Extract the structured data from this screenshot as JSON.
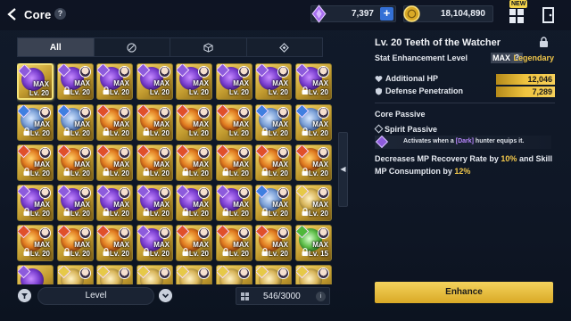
{
  "header": {
    "title": "Core",
    "help": "?",
    "crystal_amount": "7,397",
    "plus": "+",
    "gold_amount": "18,104,890",
    "new_badge": "NEW",
    "colors": {
      "accent": "#f2c84b",
      "crystal": "#a86ff0",
      "gold": "#d9a926"
    }
  },
  "tabs": [
    {
      "label": "All",
      "icon": "none"
    },
    {
      "label": "",
      "icon": "no-filter-icon"
    },
    {
      "label": "",
      "icon": "cube-icon"
    },
    {
      "label": "",
      "icon": "diamond-icon"
    }
  ],
  "core_grid": {
    "max_label": "MAX",
    "rows": [
      [
        {
          "lv": "Lv. 20",
          "max": true,
          "el": "dark",
          "face": false,
          "lock": false,
          "sel": true
        },
        {
          "lv": "Lv. 20",
          "max": true,
          "el": "dark",
          "face": true,
          "lock": true
        },
        {
          "lv": "Lv. 20",
          "max": true,
          "el": "dark",
          "face": true,
          "lock": true
        },
        {
          "lv": "Lv. 20",
          "max": true,
          "el": "dark",
          "face": true,
          "lock": false
        },
        {
          "lv": "Lv. 20",
          "max": true,
          "el": "dark",
          "face": true,
          "lock": false
        },
        {
          "lv": "Lv. 20",
          "max": true,
          "el": "dark",
          "face": true,
          "lock": false
        },
        {
          "lv": "Lv. 20",
          "max": true,
          "el": "dark",
          "face": true,
          "lock": false
        },
        {
          "lv": "Lv. 20",
          "max": true,
          "el": "dark",
          "face": true,
          "lock": true
        }
      ],
      [
        {
          "lv": "Lv. 20",
          "max": true,
          "el": "water",
          "face": true,
          "lock": true
        },
        {
          "lv": "Lv. 20",
          "max": true,
          "el": "water",
          "face": true,
          "lock": true
        },
        {
          "lv": "Lv. 20",
          "max": true,
          "el": "fire",
          "face": true,
          "lock": true
        },
        {
          "lv": "Lv. 20",
          "max": true,
          "el": "fire",
          "face": true,
          "lock": true
        },
        {
          "lv": "Lv. 20",
          "max": true,
          "el": "fire",
          "face": true,
          "lock": false
        },
        {
          "lv": "Lv. 20",
          "max": true,
          "el": "fire",
          "face": true,
          "lock": false
        },
        {
          "lv": "Lv. 20",
          "max": true,
          "el": "water",
          "face": true,
          "lock": true
        },
        {
          "lv": "Lv. 20",
          "max": true,
          "el": "water",
          "face": true,
          "lock": true
        }
      ],
      [
        {
          "lv": "Lv. 20",
          "max": true,
          "el": "fire",
          "face": true,
          "lock": true
        },
        {
          "lv": "Lv. 20",
          "max": true,
          "el": "fire",
          "face": true,
          "lock": true
        },
        {
          "lv": "Lv. 20",
          "max": true,
          "el": "fire",
          "face": true,
          "lock": true
        },
        {
          "lv": "Lv. 20",
          "max": true,
          "el": "fire",
          "face": true,
          "lock": true
        },
        {
          "lv": "Lv. 20",
          "max": true,
          "el": "fire",
          "face": true,
          "lock": true
        },
        {
          "lv": "Lv. 20",
          "max": true,
          "el": "fire",
          "face": true,
          "lock": true
        },
        {
          "lv": "Lv. 20",
          "max": true,
          "el": "fire",
          "face": true,
          "lock": true
        },
        {
          "lv": "Lv. 20",
          "max": true,
          "el": "fire",
          "face": true,
          "lock": true
        }
      ],
      [
        {
          "lv": "Lv. 20",
          "max": true,
          "el": "dark",
          "face": true,
          "lock": true
        },
        {
          "lv": "Lv. 20",
          "max": true,
          "el": "dark",
          "face": true,
          "lock": true
        },
        {
          "lv": "Lv. 20",
          "max": true,
          "el": "dark",
          "face": true,
          "lock": true
        },
        {
          "lv": "Lv. 20",
          "max": true,
          "el": "dark",
          "face": true,
          "lock": true
        },
        {
          "lv": "Lv. 20",
          "max": true,
          "el": "dark",
          "face": true,
          "lock": true
        },
        {
          "lv": "Lv. 20",
          "max": true,
          "el": "dark",
          "face": true,
          "lock": true
        },
        {
          "lv": "Lv. 20",
          "max": true,
          "el": "water",
          "face": true,
          "lock": true
        },
        {
          "lv": "Lv. 20",
          "max": true,
          "el": "light",
          "face": true,
          "lock": true
        }
      ],
      [
        {
          "lv": "Lv. 20",
          "max": true,
          "el": "fire",
          "face": true,
          "lock": true
        },
        {
          "lv": "Lv. 20",
          "max": true,
          "el": "fire",
          "face": true,
          "lock": true
        },
        {
          "lv": "Lv. 20",
          "max": true,
          "el": "fire",
          "face": true,
          "lock": true
        },
        {
          "lv": "Lv. 20",
          "max": true,
          "el": "dark",
          "face": true,
          "lock": true
        },
        {
          "lv": "Lv. 20",
          "max": true,
          "el": "fire",
          "face": true,
          "lock": true
        },
        {
          "lv": "Lv. 20",
          "max": true,
          "el": "fire",
          "face": true,
          "lock": true
        },
        {
          "lv": "Lv. 20",
          "max": true,
          "el": "fire",
          "face": true,
          "lock": true
        },
        {
          "lv": "Lv. 15",
          "max": true,
          "el": "wind",
          "face": true,
          "lock": true
        }
      ],
      [
        {
          "lv": "",
          "max": false,
          "el": "dark",
          "face": false,
          "lock": false
        },
        {
          "lv": "",
          "max": false,
          "el": "light",
          "face": true,
          "lock": false
        },
        {
          "lv": "",
          "max": false,
          "el": "light",
          "face": true,
          "lock": false
        },
        {
          "lv": "",
          "max": false,
          "el": "light",
          "face": true,
          "lock": false
        },
        {
          "lv": "",
          "max": false,
          "el": "light",
          "face": true,
          "lock": false
        },
        {
          "lv": "",
          "max": false,
          "el": "light",
          "face": true,
          "lock": false
        },
        {
          "lv": "",
          "max": false,
          "el": "light",
          "face": true,
          "lock": false
        },
        {
          "lv": "",
          "max": false,
          "el": "light",
          "face": true,
          "lock": false
        }
      ]
    ]
  },
  "bottom": {
    "sort_label": "Level",
    "count": "546/3000",
    "info": "i"
  },
  "detail": {
    "title": "Lv. 20 Teeth of the Watcher",
    "stat_level_label": "Stat Enhancement Level",
    "stat_level_value": "MAX",
    "help": "?",
    "rarity": "Legendary",
    "stats": [
      {
        "name": "Additional HP",
        "value": "12,046",
        "icon": "heart-icon"
      },
      {
        "name": "Defense Penetration",
        "value": "7,289",
        "icon": "shield-icon"
      }
    ],
    "core_passive_label": "Core Passive",
    "spirit_passive_label": "Spirit Passive",
    "condition_pre": "Activates when a ",
    "condition_hl": "[Dark]",
    "condition_post": " hunter equips it.",
    "desc_1": "Decreases MP Recovery Rate by ",
    "desc_1_val": "10%",
    "desc_2": " and Skill MP Consumption by ",
    "desc_2_val": "12%",
    "enhance_label": "Enhance"
  }
}
